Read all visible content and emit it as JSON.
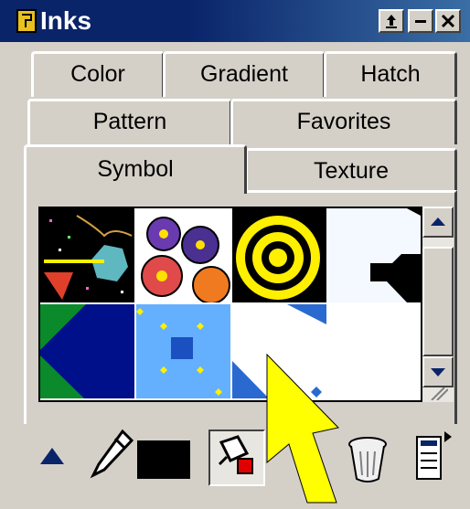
{
  "window": {
    "title": "Inks",
    "buttons": [
      "expand-button",
      "minimize-button",
      "close-button"
    ]
  },
  "tabs": [
    {
      "label": "Color"
    },
    {
      "label": "Gradient"
    },
    {
      "label": "Hatch"
    },
    {
      "label": "Pattern"
    },
    {
      "label": "Favorites"
    },
    {
      "label": "Symbol",
      "selected": true
    },
    {
      "label": "Texture"
    }
  ],
  "swatches": [
    "confetti-symbol",
    "flowers-symbol",
    "target-symbol",
    "white-shapes-symbol",
    "green-blue-triangles-symbol",
    "blue-square-dots-symbol",
    "white-blue-corner-symbol"
  ],
  "toolbar": {
    "icons": [
      "scroll-up-arrow-icon",
      "pen-icon",
      "fill-bucket-icon",
      "trash-can-icon",
      "menu-icon"
    ],
    "fill_color": "#000000"
  },
  "colors": {
    "title_bar": "#0a246a",
    "face": "#d4d0c8",
    "cursor": "#ffff00"
  }
}
